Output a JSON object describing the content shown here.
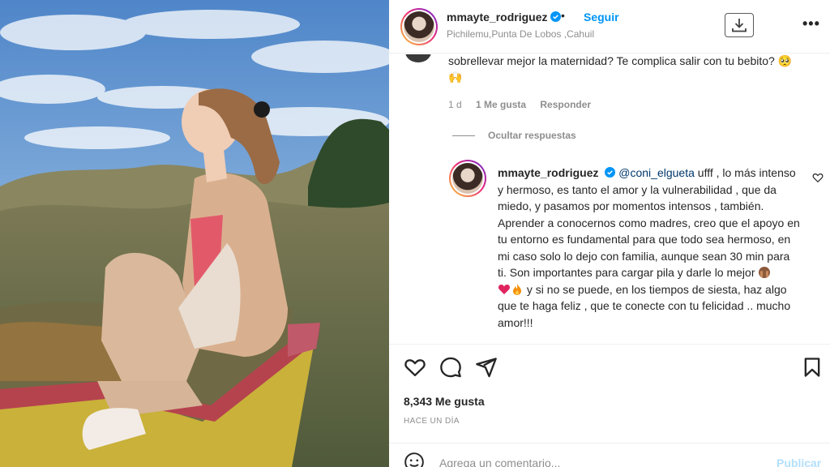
{
  "header": {
    "username": "mmayte_rodriguez",
    "follow_label": "Seguir",
    "separator": "•",
    "location": "Pichilemu,Punta De Lobos ,Cahuil",
    "more_label": "•••"
  },
  "previous_comment": {
    "text": "sobrellevar mejor la maternidad? Te complica salir con tu bebito? 🥺🙌",
    "time": "1 d",
    "likes": "1 Me gusta",
    "reply_label": "Responder"
  },
  "hide_replies_label": "Ocultar respuestas",
  "reply": {
    "username": "mmayte_rodriguez",
    "mention": "@coni_elgueta",
    "text_part1": " ufff , lo más intenso y hermoso, es tanto el amor y la vulnerabilidad , que da miedo, y pasamos por momentos intensos , también. Aprender a conocernos como madres, creo que el apoyo en tu entorno es fundamental para que todo sea hermoso, en mi caso solo lo dejo con familia, aunque sean 30 min para ti. Son importantes para cargar pila y darle lo mejor ",
    "text_part2": " y si no se puede, en los tiempos de siesta, haz algo que te haga feliz , que te conecte con tu felicidad .. mucho amor!!!"
  },
  "post": {
    "likes": "8,343 Me gusta",
    "date": "HACE UN DÍA"
  },
  "add_comment": {
    "placeholder": "Agrega un comentario...",
    "publish_label": "Publicar"
  },
  "colors": {
    "accent": "#0095f6",
    "mention": "#00376b",
    "muted": "#8e8e8e",
    "publish_disabled": "#b2dffc"
  },
  "icons": {
    "verified": "verified-badge-icon",
    "download": "download-icon",
    "more": "more-options-icon",
    "like": "heart-icon",
    "comment": "comment-icon",
    "share": "share-icon",
    "save": "bookmark-icon",
    "emoji": "smiley-icon"
  }
}
